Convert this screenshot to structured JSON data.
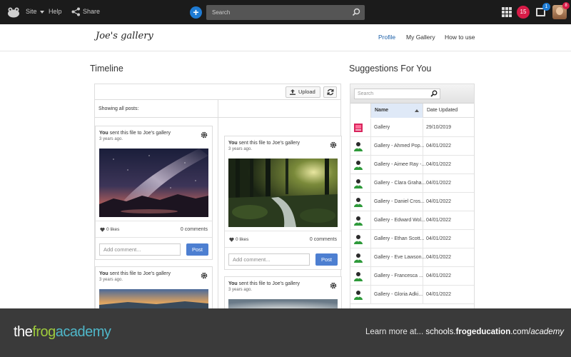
{
  "topbar": {
    "site_label": "Site",
    "help_label": "Help",
    "share_label": "Share",
    "search_placeholder": "Search",
    "notification_count": "15",
    "inbox_count": "1",
    "avatar_count": "8"
  },
  "header": {
    "title": "Joe's gallery",
    "nav": {
      "profile": "Profile",
      "my_gallery": "My Gallery",
      "how_to_use": "How to use"
    }
  },
  "timeline": {
    "title": "Timeline",
    "upload_label": "Upload",
    "showing_label": "Showing all posts:",
    "posts": [
      {
        "author": "You",
        "action": "sent this file to Joe's gallery",
        "time": "3 years ago.",
        "likes": "0 likes",
        "comments": "0 comments",
        "comment_placeholder": "Add comment...",
        "post_label": "Post"
      },
      {
        "author": "You",
        "action": "sent this file to Joe's gallery",
        "time": "3 years ago.",
        "likes": "0 likes",
        "comments": "0 comments",
        "comment_placeholder": "Add comment...",
        "post_label": "Post"
      },
      {
        "author": "You",
        "action": "sent this file to Joe's gallery",
        "time": "3 years ago."
      },
      {
        "author": "You",
        "action": "sent this file to Joe's gallery",
        "time": "3 years ago."
      }
    ]
  },
  "suggestions": {
    "title": "Suggestions For You",
    "search_placeholder": "Search",
    "columns": {
      "name": "Name",
      "date": "Date Updated"
    },
    "rows": [
      {
        "name": "Gallery",
        "date": "29/10/2019",
        "icon": "gallery-icon"
      },
      {
        "name": "Gallery - Ahmed Pop...",
        "date": "04/01/2022",
        "icon": "user-icon"
      },
      {
        "name": "Gallery - Aimee Ray -...",
        "date": "04/01/2022",
        "icon": "user-icon"
      },
      {
        "name": "Gallery - Clara Graha...",
        "date": "04/01/2022",
        "icon": "user-icon"
      },
      {
        "name": "Gallery - Daniel Cros...",
        "date": "04/01/2022",
        "icon": "user-icon"
      },
      {
        "name": "Gallery - Edward Wol...",
        "date": "04/01/2022",
        "icon": "user-icon"
      },
      {
        "name": "Gallery - Ethan Scott...",
        "date": "04/01/2022",
        "icon": "user-icon"
      },
      {
        "name": "Gallery - Eve Lawson...",
        "date": "04/01/2022",
        "icon": "user-icon"
      },
      {
        "name": "Gallery - Francesca ...",
        "date": "04/01/2022",
        "icon": "user-icon"
      },
      {
        "name": "Gallery - Gloria Adki...",
        "date": "04/01/2022",
        "icon": "user-icon"
      }
    ]
  },
  "footer": {
    "brand_the": "the",
    "brand_frog": "frog",
    "brand_academy": "academy",
    "cta_prefix": "Learn more at... ",
    "cta_url_a": "schools.",
    "cta_url_b": "frogeducation",
    "cta_url_c": ".com/",
    "cta_url_d": "academy"
  },
  "colors": {
    "topbar": "#1b1b1b",
    "accent_blue": "#1e7bd4",
    "badge_red": "#d81b47",
    "post_button": "#4d7fd1",
    "footer": "#3a3a3a",
    "brand_green": "#9ecb3c",
    "brand_teal": "#4fb7c9"
  }
}
